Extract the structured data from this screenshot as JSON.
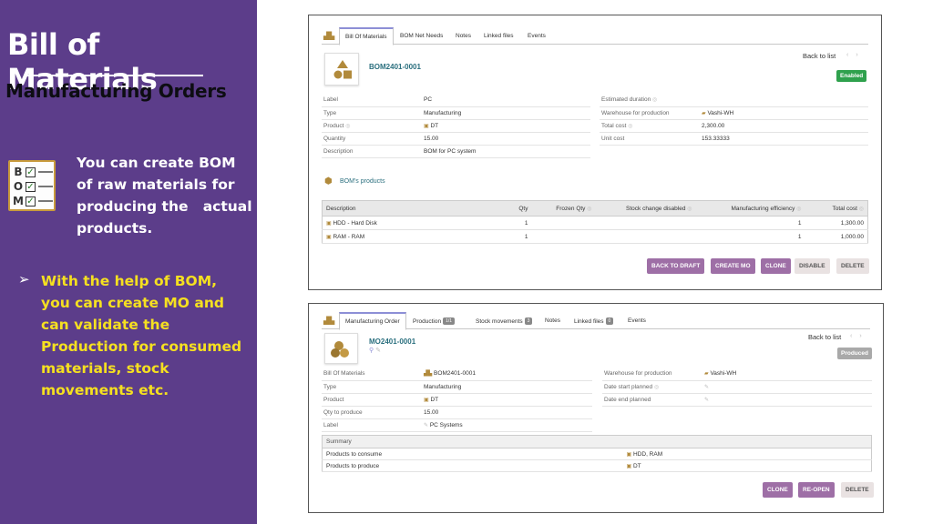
{
  "slide": {
    "title": "Bill of Materials",
    "subtitle": "Manufacturing Orders",
    "icon_letters": [
      "B",
      "O",
      "M"
    ],
    "bom_text": "You can create BOM\nof raw materials for\nproducing the   actual\nproducts.",
    "bullet_text": "With the help of BOM,\nyou can create MO and\ncan validate the\nProduction for consumed\nmaterials, stock\nmovements etc."
  },
  "colors": {
    "panel_purple": "#5c3d8a",
    "highlight_yellow": "#f5e020",
    "status_enabled": "#2fa14d",
    "status_produced": "#a9a9a9",
    "button_purple": "#9e6fa6"
  },
  "bom_card": {
    "tabs": [
      "Bill Of Materials",
      "BOM Net Needs",
      "Notes",
      "Linked files",
      "Events"
    ],
    "ref": "BOM2401-0001",
    "back_to_list": "Back to list",
    "status": "Enabled",
    "fields_left": [
      {
        "label": "Label",
        "value": "PC"
      },
      {
        "label": "Type",
        "value": "Manufacturing"
      },
      {
        "label": "Product",
        "value": "DT"
      },
      {
        "label": "Quantity",
        "value": "15.00"
      },
      {
        "label": "Description",
        "value": "BOM for PC system"
      }
    ],
    "fields_right": [
      {
        "label": "Estimated duration",
        "value": ""
      },
      {
        "label": "Warehouse for production",
        "value": "Vashi-WH"
      },
      {
        "label": "Total cost",
        "value": "2,300.00"
      },
      {
        "label": "Unit cost",
        "value": "153.33333"
      }
    ],
    "products_title": "BOM's products",
    "columns": [
      "Description",
      "Qty",
      "Frozen Qty",
      "Stock change disabled",
      "Manufacturing efficiency",
      "Total cost"
    ],
    "rows": [
      {
        "description": "HDD - Hard Disk",
        "qty": "1",
        "efficiency": "1",
        "total": "1,300.00"
      },
      {
        "description": "RAM - RAM",
        "qty": "1",
        "efficiency": "1",
        "total": "1,000.00"
      }
    ],
    "buttons": [
      "BACK TO DRAFT",
      "CREATE MO",
      "CLONE",
      "DISABLE",
      "DELETE"
    ]
  },
  "mo_card": {
    "tabs": [
      "Manufacturing Order",
      "Production",
      "Stock movements",
      "Notes",
      "Linked files",
      "Events"
    ],
    "badges": {
      "production": "1/1",
      "stock": "3",
      "linked": "0"
    },
    "ref": "MO2401-0001",
    "back_to_list": "Back to list",
    "status": "Produced",
    "fields_left": [
      {
        "label": "Bill Of Materials",
        "value": "BOM2401-0001"
      },
      {
        "label": "Type",
        "value": "Manufacturing"
      },
      {
        "label": "Product",
        "value": "DT"
      },
      {
        "label": "Qty to produce",
        "value": "15.00"
      },
      {
        "label": "Label",
        "value": "PC Systems"
      }
    ],
    "fields_right": [
      {
        "label": "Warehouse for production",
        "value": "Vashi-WH"
      },
      {
        "label": "Date start planned",
        "value": ""
      },
      {
        "label": "Date end planned",
        "value": ""
      }
    ],
    "summary_title": "Summary",
    "summary_rows": [
      {
        "label": "Products to consume",
        "value": "HDD, RAM"
      },
      {
        "label": "Products to produce",
        "value": "DT"
      }
    ],
    "buttons": [
      "CLONE",
      "RE-OPEN",
      "DELETE"
    ]
  }
}
